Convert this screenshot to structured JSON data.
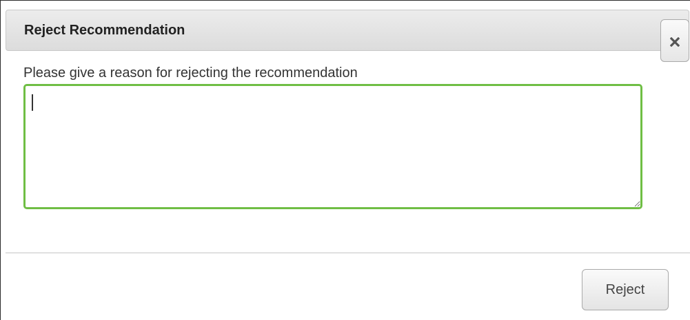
{
  "dialog": {
    "title": "Reject Recommendation",
    "prompt": "Please give a reason for rejecting the recommendation",
    "reason_value": "",
    "reject_label": "Reject",
    "close_icon": "close-icon"
  }
}
